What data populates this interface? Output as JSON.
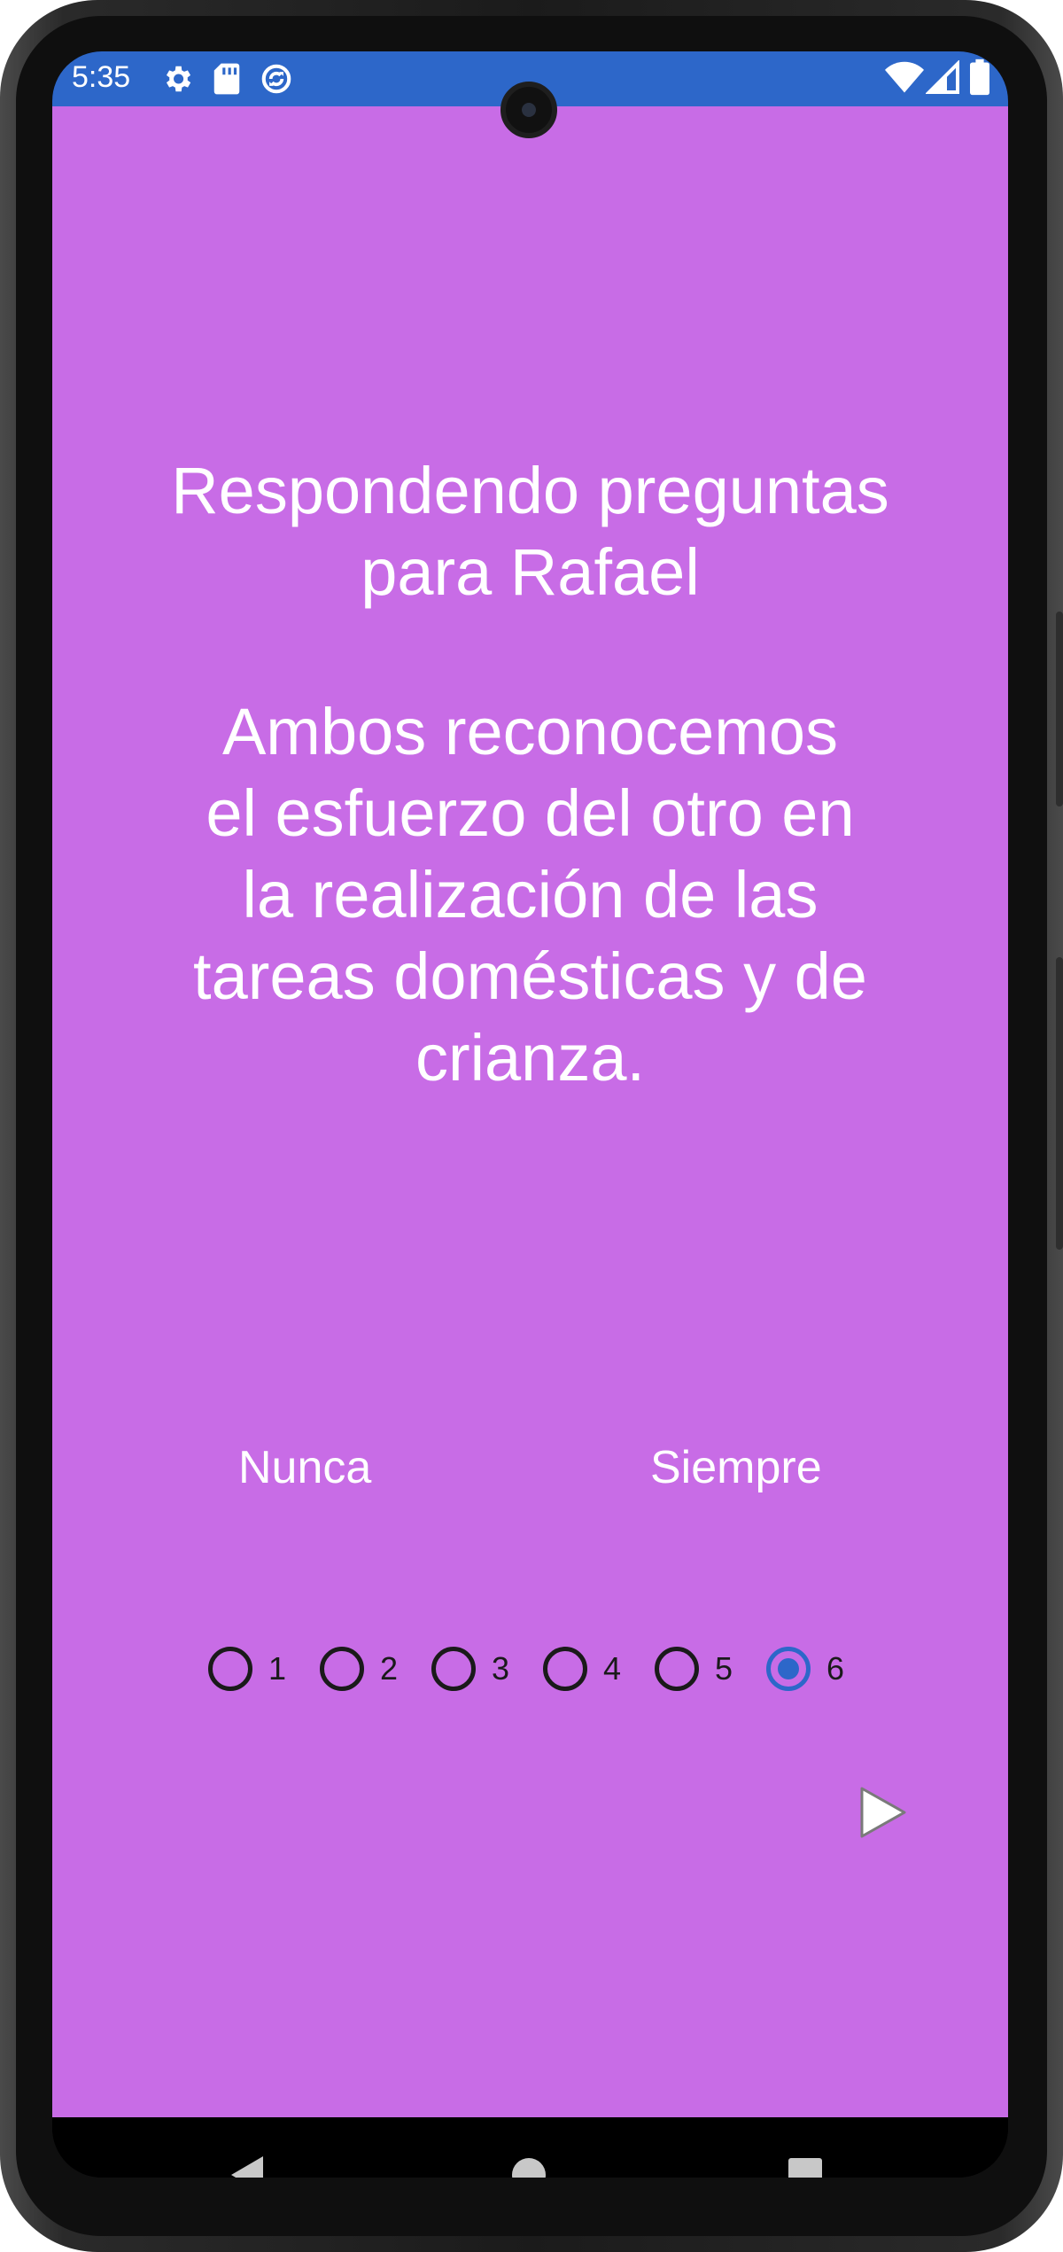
{
  "status_bar": {
    "time": "5:35",
    "background": "#2d67c9",
    "left_icons": [
      "gear-icon",
      "sd-card-icon",
      "sync-icon"
    ],
    "right_icons": [
      "wifi-icon",
      "signal-icon",
      "battery-icon"
    ]
  },
  "app": {
    "background": "#c86ce6",
    "title_line1": "Respondendo preguntas",
    "title_line2": "para Rafael",
    "question_line1": "Ambos reconocemos",
    "question_line2": "el esfuerzo del otro en",
    "question_line3": "la realización de las",
    "question_line4": "tareas domésticas y de",
    "question_line5": "crianza.",
    "scale_min_label": "Nunca",
    "scale_max_label": "Siempre",
    "options": [
      {
        "label": "1",
        "checked": false
      },
      {
        "label": "2",
        "checked": false
      },
      {
        "label": "3",
        "checked": false
      },
      {
        "label": "4",
        "checked": false
      },
      {
        "label": "5",
        "checked": false
      },
      {
        "label": "6",
        "checked": true
      }
    ],
    "selected_value": "6",
    "next_icon": "play-arrow-icon"
  },
  "nav_bar": {
    "buttons": [
      "back-icon",
      "home-icon",
      "recents-icon"
    ]
  }
}
